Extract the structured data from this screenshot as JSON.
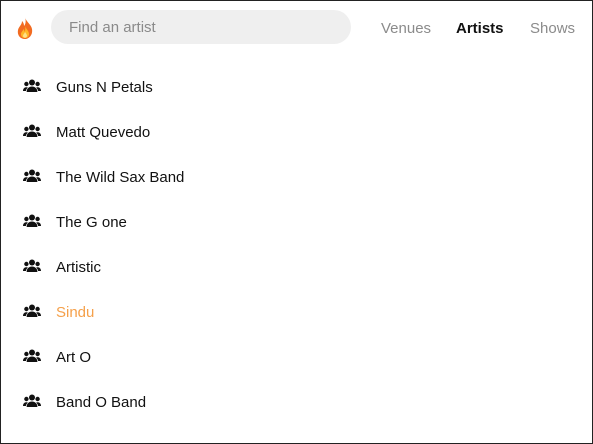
{
  "colors": {
    "accent": "#f5a04a",
    "nav_inactive": "#8b8b8b",
    "search_bg": "#efefef",
    "text": "#111111"
  },
  "header": {
    "logo_icon": "fire-icon",
    "search": {
      "placeholder": "Find an artist",
      "value": ""
    },
    "nav": [
      {
        "label": "Venues",
        "active": false
      },
      {
        "label": "Artists",
        "active": true
      },
      {
        "label": "Shows",
        "active": false
      }
    ]
  },
  "artists": {
    "icon": "users-icon",
    "items": [
      {
        "name": "Guns N Petals",
        "highlighted": false
      },
      {
        "name": "Matt Quevedo",
        "highlighted": false
      },
      {
        "name": "The Wild Sax Band",
        "highlighted": false
      },
      {
        "name": "The G one",
        "highlighted": false
      },
      {
        "name": "Artistic",
        "highlighted": false
      },
      {
        "name": "Sindu",
        "highlighted": true
      },
      {
        "name": "Art O",
        "highlighted": false
      },
      {
        "name": "Band O Band",
        "highlighted": false
      }
    ]
  }
}
